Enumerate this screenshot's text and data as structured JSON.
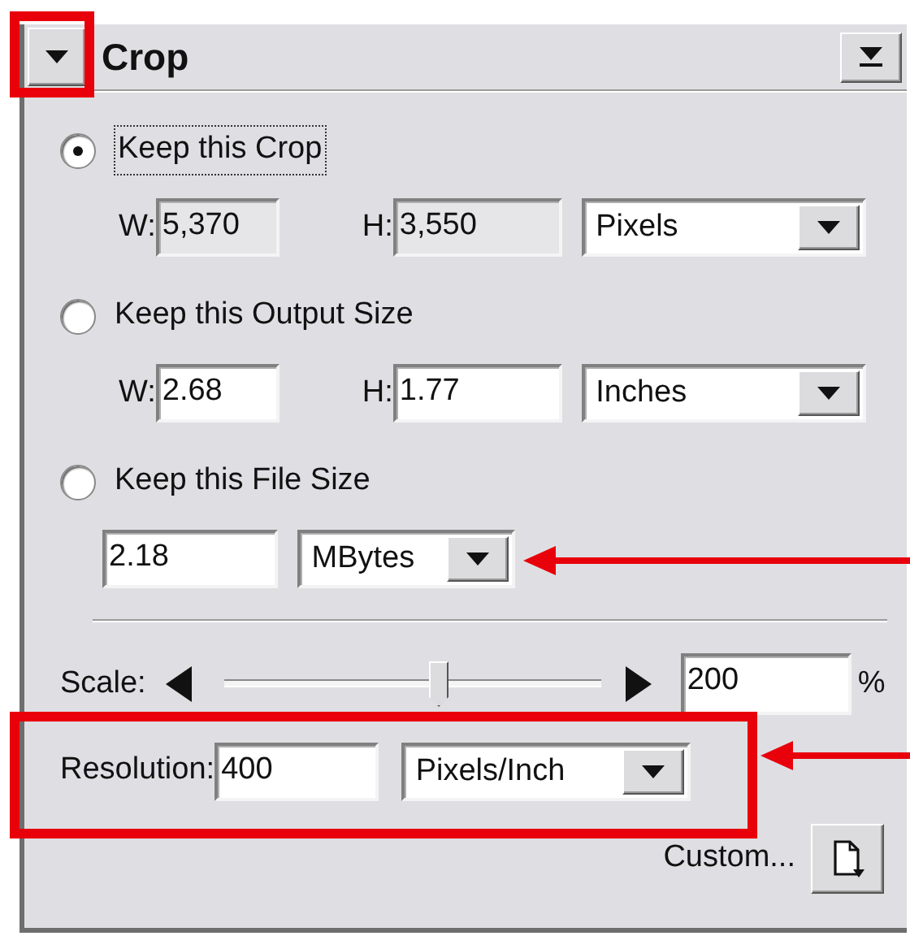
{
  "panel": {
    "title": "Crop",
    "collapse_highlighted": true
  },
  "options": [
    {
      "kind": "wh",
      "label": "Keep this Crop",
      "selected": true,
      "w_label": "W:",
      "w_value": "5,370",
      "h_label": "H:",
      "h_value": "3,550",
      "readonly": true,
      "unit": "Pixels"
    },
    {
      "kind": "wh",
      "label": "Keep this Output Size",
      "selected": false,
      "w_label": "W:",
      "w_value": "2.68",
      "h_label": "H:",
      "h_value": "1.77",
      "readonly": false,
      "unit": "Inches"
    },
    {
      "kind": "size",
      "label": "Keep this File Size",
      "selected": false,
      "value": "2.18",
      "readonly": false,
      "unit": "MBytes",
      "unit_pointed": true
    }
  ],
  "scale": {
    "label": "Scale:",
    "level": 0.57,
    "value": "200",
    "unit": "%"
  },
  "resolution": {
    "label": "Resolution:",
    "value": "400",
    "unit": "Pixels/Inch",
    "highlighted": true,
    "pointed": true
  },
  "custom": {
    "label": "Custom..."
  }
}
